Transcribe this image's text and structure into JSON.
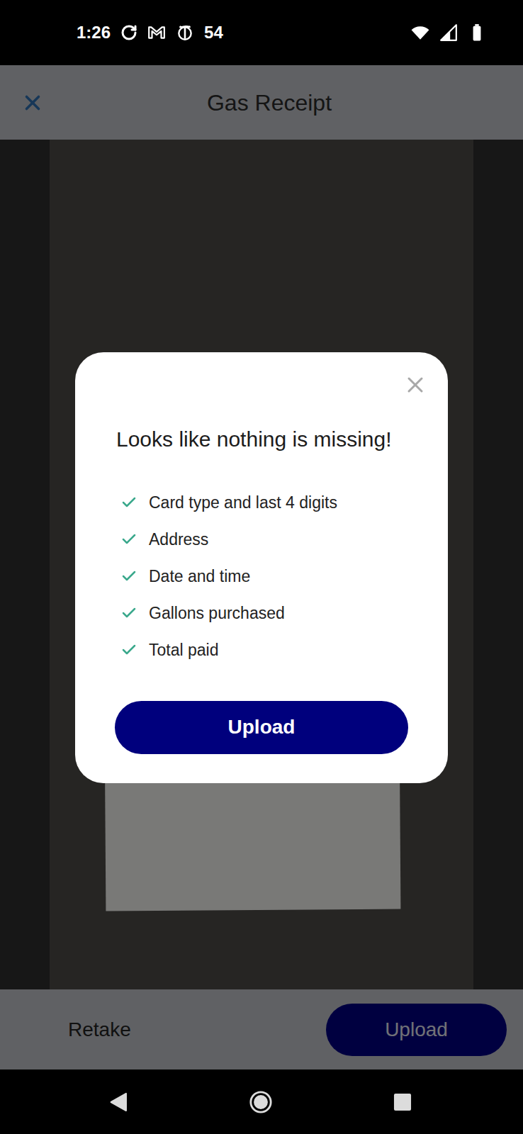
{
  "status_bar": {
    "time": "1:26",
    "notification_count": "54"
  },
  "header": {
    "title": "Gas Receipt"
  },
  "dialog": {
    "title": "Looks like nothing is missing!",
    "checklist": [
      {
        "label": "Card type and last 4 digits",
        "checked": true
      },
      {
        "label": "Address",
        "checked": true
      },
      {
        "label": "Date and time",
        "checked": true
      },
      {
        "label": "Gallons purchased",
        "checked": true
      },
      {
        "label": "Total paid",
        "checked": true
      }
    ],
    "button": "Upload"
  },
  "bottom_bar": {
    "secondary_button": "Retake",
    "primary_button": "Upload"
  }
}
